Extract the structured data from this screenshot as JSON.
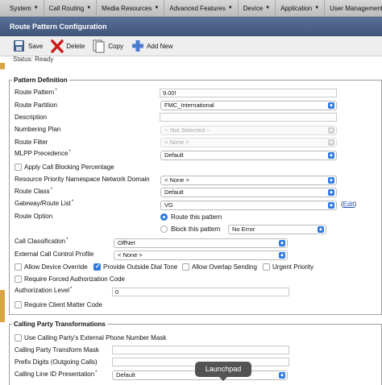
{
  "menu": {
    "items": [
      {
        "label": "System"
      },
      {
        "label": "Call Routing"
      },
      {
        "label": "Media Resources"
      },
      {
        "label": "Advanced Features"
      },
      {
        "label": "Device"
      },
      {
        "label": "Application"
      },
      {
        "label": "User Management"
      }
    ]
  },
  "page": {
    "title": "Route Pattern Configuration"
  },
  "toolbar": {
    "save_label": "Save",
    "delete_label": "Delete",
    "copy_label": "Copy",
    "addnew_label": "Add New"
  },
  "status": {
    "text": "Status: Ready"
  },
  "pattern_definition": {
    "title": "Pattern Definition",
    "route_pattern": {
      "label": "Route Pattern",
      "value": "9.00!"
    },
    "route_partition": {
      "label": "Route Partition",
      "value": "FMC_International"
    },
    "description": {
      "label": "Description",
      "value": ""
    },
    "numbering_plan": {
      "label": "Numbering Plan",
      "value": "-- Not Selected --"
    },
    "route_filter": {
      "label": "Route Filter",
      "value": "< None >"
    },
    "mlpp_precedence": {
      "label": "MLPP Precedence",
      "value": "Default"
    },
    "apply_call_blocking": {
      "label": "Apply Call Blocking Percentage"
    },
    "resource_priority": {
      "label": "Resource Priority Namespace Network Domain",
      "value": "< None >"
    },
    "route_class": {
      "label": "Route Class",
      "value": "Default"
    },
    "gateway_route_list": {
      "label": "Gateway/Route List",
      "value": "VG",
      "edit_label": "Edit"
    },
    "route_option": {
      "label": "Route Option",
      "route_this": "Route this pattern",
      "block_this": "Block this pattern",
      "block_reason": "No Error"
    },
    "call_classification": {
      "label": "Call Classification",
      "value": "OffNet"
    },
    "external_call_control": {
      "label": "External Call Control Profile",
      "value": "< None >"
    },
    "allow_device_override": {
      "label": "Allow Device Override"
    },
    "provide_outside_dial_tone": {
      "label": "Provide Outside Dial Tone"
    },
    "allow_overlap_sending": {
      "label": "Allow Overlap Sending"
    },
    "urgent_priority": {
      "label": "Urgent Priority"
    },
    "require_fac": {
      "label": "Require Forced Authorization Code"
    },
    "authorization_level": {
      "label": "Authorization Level",
      "value": "0"
    },
    "require_cmc": {
      "label": "Require Client Matter Code"
    }
  },
  "calling_party": {
    "title": "Calling Party Transformations",
    "use_external_mask": {
      "label": "Use Calling Party's External Phone Number Mask"
    },
    "transform_mask": {
      "label": "Calling Party Transform Mask",
      "value": ""
    },
    "prefix_digits": {
      "label": "Prefix Digits (Outgoing Calls)",
      "value": ""
    },
    "line_id_presentation": {
      "label": "Calling Line ID Presentation",
      "value": "Default"
    }
  },
  "dock": {
    "tooltip": "Launchpad"
  },
  "colors": {
    "accent": "#2f79e3",
    "title_bar": "#4a6087",
    "menubar": "#c9c9c9"
  }
}
